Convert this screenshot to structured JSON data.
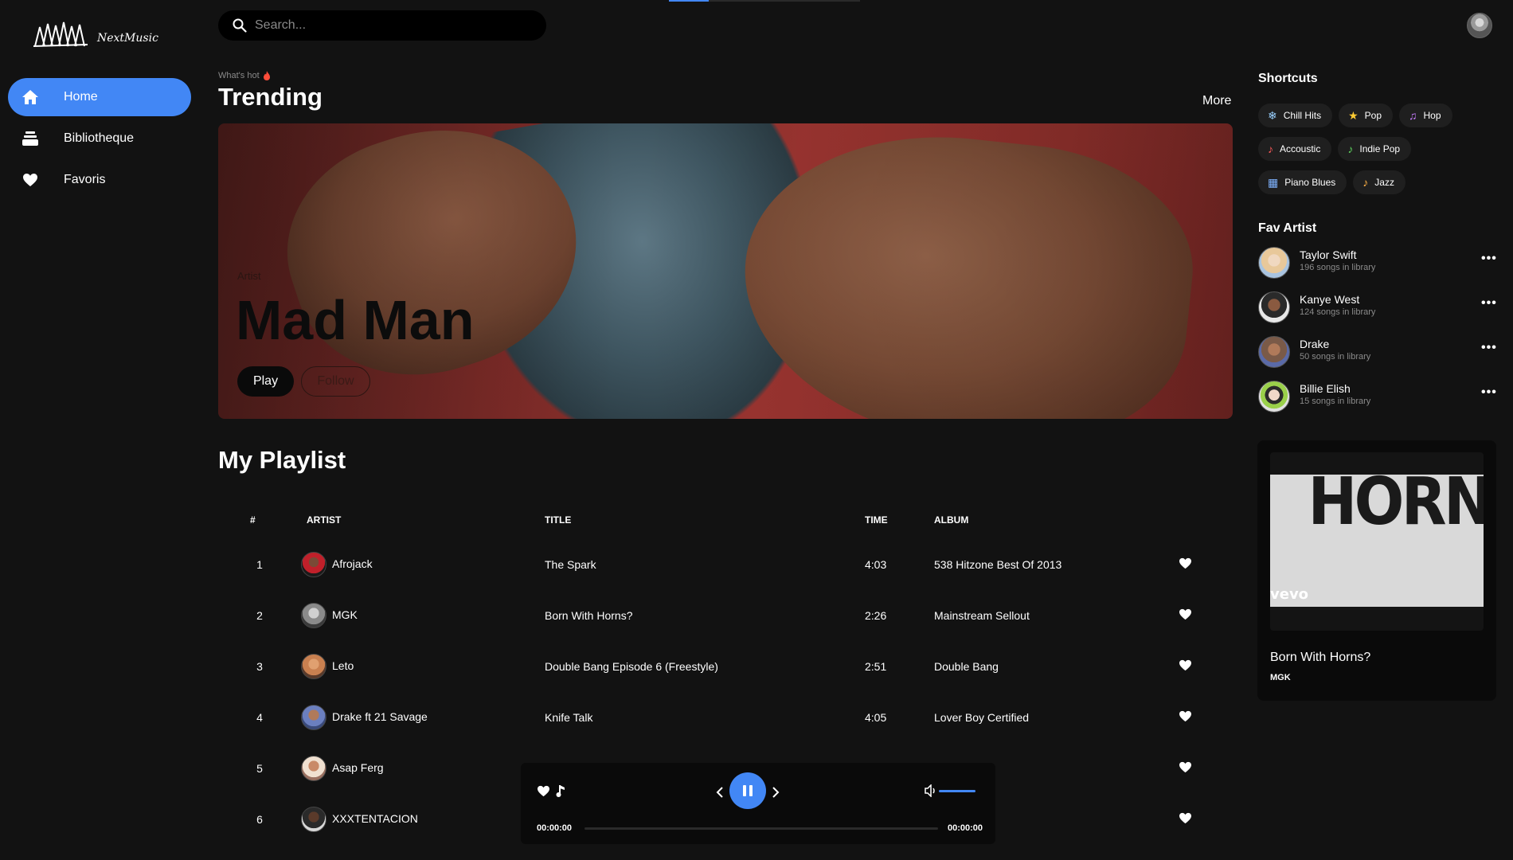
{
  "app": {
    "logo_text": "NextMusic"
  },
  "sidebar": {
    "items": [
      {
        "label": "Home",
        "icon": "home-icon",
        "active": true
      },
      {
        "label": "Bibliotheque",
        "icon": "library-icon",
        "active": false
      },
      {
        "label": "Favoris",
        "icon": "heart-icon",
        "active": false
      }
    ]
  },
  "search": {
    "placeholder": "Search..."
  },
  "trending": {
    "eyebrow": "What's hot",
    "title": "Trending",
    "more_label": "More",
    "hero": {
      "label": "Artist",
      "name": "Mad Man",
      "play_label": "Play",
      "follow_label": "Follow"
    }
  },
  "playlist": {
    "title": "My Playlist",
    "columns": {
      "num": "#",
      "artist": "ARTIST",
      "title": "TITLE",
      "time": "TIME",
      "album": "ALBUM"
    },
    "rows": [
      {
        "num": "1",
        "artist": "Afrojack",
        "title": "The Spark",
        "time": "4:03",
        "album": "538 Hitzone Best Of 2013"
      },
      {
        "num": "2",
        "artist": "MGK",
        "title": "Born With Horns?",
        "time": "2:26",
        "album": "Mainstream Sellout"
      },
      {
        "num": "3",
        "artist": "Leto",
        "title": "Double Bang Episode 6 (Freestyle)",
        "time": "2:51",
        "album": "Double Bang"
      },
      {
        "num": "4",
        "artist": "Drake ft 21 Savage",
        "title": "Knife Talk",
        "time": "4:05",
        "album": "Lover Boy Certified"
      },
      {
        "num": "5",
        "artist": "Asap Ferg",
        "title": "",
        "time": "",
        "album": ""
      },
      {
        "num": "6",
        "artist": "XXXTENTACION",
        "title": "",
        "time": "",
        "album": ""
      }
    ]
  },
  "shortcuts": {
    "title": "Shortcuts",
    "rows": [
      [
        {
          "label": "Chill Hits",
          "icon": "snowflake-icon",
          "glyph": "❄",
          "color": "#9ad1ff"
        },
        {
          "label": "Pop",
          "icon": "star-icon",
          "glyph": "★",
          "color": "#ffcc33"
        },
        {
          "label": "Hop",
          "icon": "music-note-icon",
          "glyph": "♫",
          "color": "#c77dff"
        }
      ],
      [
        {
          "label": "Accoustic",
          "icon": "guitar-icon",
          "glyph": "♪",
          "color": "#ff5a5a"
        },
        {
          "label": "Indie Pop",
          "icon": "guitar-green-icon",
          "glyph": "♪",
          "color": "#5fd35f"
        }
      ],
      [
        {
          "label": "Piano Blues",
          "icon": "piano-icon",
          "glyph": "▦",
          "color": "#7fb3ff"
        },
        {
          "label": "Jazz",
          "icon": "saxophone-icon",
          "glyph": "♪",
          "color": "#ffb347"
        }
      ]
    ]
  },
  "fav_artists": {
    "title": "Fav Artist",
    "items": [
      {
        "name": "Taylor Swift",
        "sub": "196 songs in library"
      },
      {
        "name": "Kanye West",
        "sub": "124 songs in library"
      },
      {
        "name": "Drake",
        "sub": "50 songs in library"
      },
      {
        "name": "Billie Elish",
        "sub": "15 songs in library"
      }
    ]
  },
  "now_playing": {
    "art_text": "HORNS",
    "art_watermark": "vevo",
    "title": "Born With Horns?",
    "artist": "MGK"
  },
  "player": {
    "time_elapsed": "00:00:00",
    "time_total": "00:00:00",
    "progress": 0,
    "volume": 1.0
  },
  "colors": {
    "accent": "#4287f5",
    "background": "#121212",
    "surface": "#000000"
  }
}
